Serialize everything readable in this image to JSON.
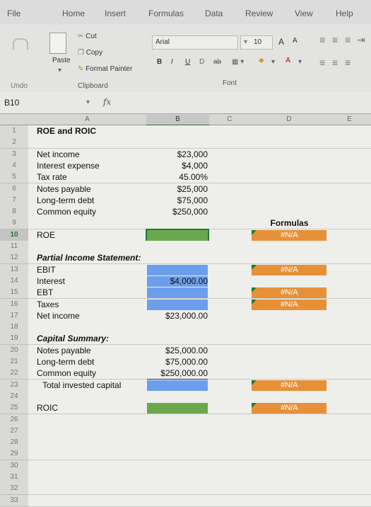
{
  "ribbon_tabs": [
    "File",
    "Home",
    "Insert",
    "Formulas",
    "Data",
    "Review",
    "View",
    "Help"
  ],
  "ribbon": {
    "undo": "Undo",
    "paste": "Paste",
    "cut": "Cut",
    "copy": "Copy",
    "format_painter": "Format Painter",
    "clipboard_group": "Clipboard",
    "font_name": "Arial",
    "font_size": "10",
    "font_group": "Font",
    "bold": "B",
    "italic": "I",
    "underline": "U",
    "grow": "A",
    "shrink": "A"
  },
  "formula_bar": {
    "name_box": "B10",
    "fx": "fx",
    "value": ""
  },
  "columns": [
    "A",
    "B",
    "C",
    "D",
    "E"
  ],
  "rows": [
    {
      "n": "1",
      "a": "ROE and ROIC",
      "b": "",
      "d": ""
    },
    {
      "n": "2",
      "a": "",
      "b": "",
      "d": ""
    },
    {
      "n": "3",
      "a": "Net income",
      "b": "$23,000",
      "d": ""
    },
    {
      "n": "4",
      "a": "Interest expense",
      "b": "$4,000",
      "d": ""
    },
    {
      "n": "5",
      "a": "Tax rate",
      "b": "45.00%",
      "d": ""
    },
    {
      "n": "6",
      "a": "Notes payable",
      "b": "$25,000",
      "d": ""
    },
    {
      "n": "7",
      "a": "Long-term debt",
      "b": "$75,000",
      "d": ""
    },
    {
      "n": "8",
      "a": "Common equity",
      "b": "$250,000",
      "d": ""
    },
    {
      "n": "9",
      "a": "",
      "b": "",
      "d": "Formulas"
    },
    {
      "n": "10",
      "a": "ROE",
      "b": "",
      "d": "#N/A"
    },
    {
      "n": "11",
      "a": "",
      "b": "",
      "d": ""
    },
    {
      "n": "12",
      "a": "Partial Income Statement:",
      "b": "",
      "d": ""
    },
    {
      "n": "13",
      "a": "EBIT",
      "b": "",
      "d": "#N/A"
    },
    {
      "n": "14",
      "a": "Interest",
      "b": "$4,000.00",
      "d": ""
    },
    {
      "n": "15",
      "a": "EBT",
      "b": "",
      "d": "#N/A"
    },
    {
      "n": "16",
      "a": "Taxes",
      "b": "",
      "d": "#N/A"
    },
    {
      "n": "17",
      "a": "Net income",
      "b": "$23,000.00",
      "d": ""
    },
    {
      "n": "18",
      "a": "",
      "b": "",
      "d": ""
    },
    {
      "n": "19",
      "a": "Capital Summary:",
      "b": "",
      "d": ""
    },
    {
      "n": "20",
      "a": "Notes payable",
      "b": "$25,000.00",
      "d": ""
    },
    {
      "n": "21",
      "a": "Long-term debt",
      "b": "$75,000.00",
      "d": ""
    },
    {
      "n": "22",
      "a": "Common equity",
      "b": "$250,000.00",
      "d": ""
    },
    {
      "n": "23",
      "a": "Total invested capital",
      "b": "",
      "d": "#N/A"
    },
    {
      "n": "24",
      "a": "",
      "b": "",
      "d": ""
    },
    {
      "n": "25",
      "a": "ROIC",
      "b": "",
      "d": "#N/A"
    },
    {
      "n": "26",
      "a": "",
      "b": "",
      "d": ""
    },
    {
      "n": "27",
      "a": "",
      "b": "",
      "d": ""
    },
    {
      "n": "28",
      "a": "",
      "b": "",
      "d": ""
    },
    {
      "n": "29",
      "a": "",
      "b": "",
      "d": ""
    },
    {
      "n": "30",
      "a": "",
      "b": "",
      "d": ""
    },
    {
      "n": "31",
      "a": "",
      "b": "",
      "d": ""
    },
    {
      "n": "32",
      "a": "",
      "b": "",
      "d": ""
    },
    {
      "n": "33",
      "a": "",
      "b": "",
      "d": ""
    }
  ],
  "colors": {
    "green": "#6aa84f",
    "blue": "#6d9eeb",
    "orange": "#e69138"
  }
}
